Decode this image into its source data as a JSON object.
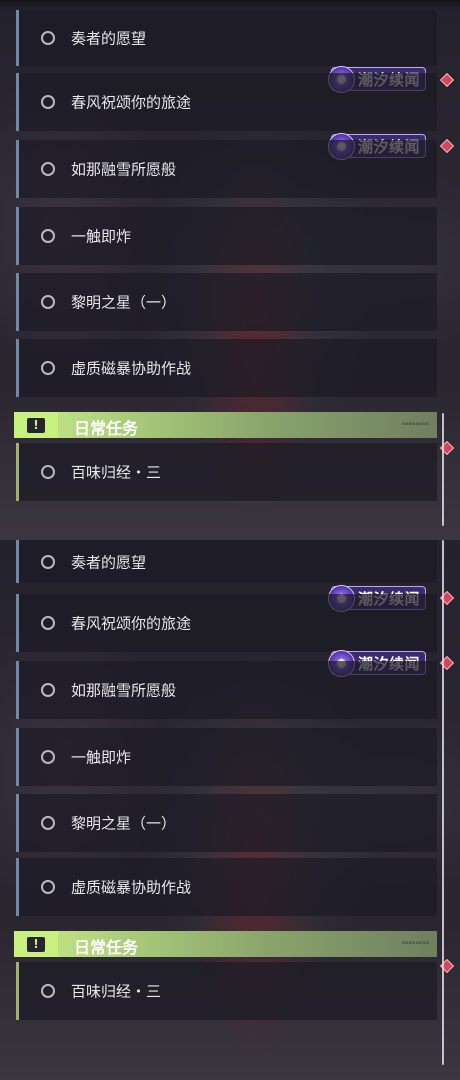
{
  "quests": [
    {
      "label": "奏者的愿望"
    },
    {
      "label": "春风祝颂你的旅途"
    },
    {
      "label": "如那融雪所愿般"
    },
    {
      "label": "一触即炸"
    },
    {
      "label": "黎明之星（一）"
    },
    {
      "label": "虚质磁暴协助作战"
    }
  ],
  "tag_label": "潮汐续闻",
  "daily": {
    "title": "日常任务",
    "icon": "!",
    "item": "百味归经・三"
  },
  "colors": {
    "row_accent": "#6f8aa6",
    "daily_accent": "#c8f07e",
    "tag_bg": "#3b2a6e",
    "diamond": "#d8455a"
  },
  "icons": [
    "quest-circle-icon",
    "tide-icon",
    "alert-icon",
    "diamond-marker-icon"
  ]
}
